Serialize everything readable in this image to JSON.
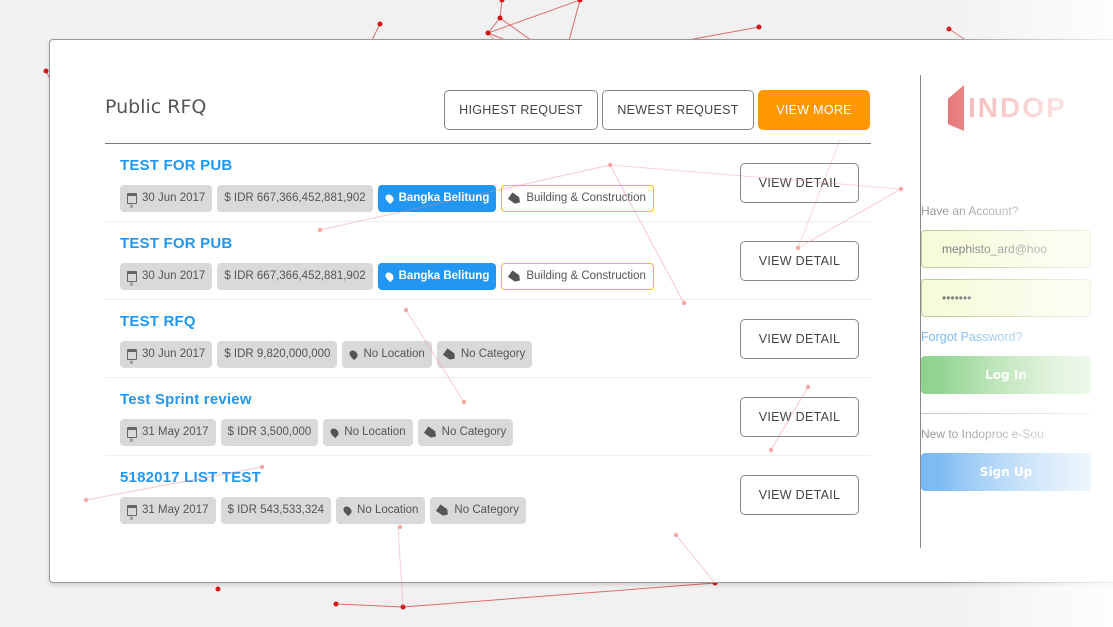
{
  "panel": {
    "title": "Public RFQ",
    "filters": {
      "highest": "HIGHEST REQUEST",
      "newest": "NEWEST REQUEST",
      "view_more": "VIEW MORE"
    },
    "detail_label": "VIEW DETAIL",
    "items": [
      {
        "title": "TEST FOR PUB",
        "date": "30 Jun 2017",
        "price": "$ IDR 667,366,452,881,902",
        "location": "Bangka Belitung",
        "category": "Building & Construction"
      },
      {
        "title": "TEST FOR PUB",
        "date": "30 Jun 2017",
        "price": "$ IDR 667,366,452,881,902",
        "location": "Bangka Belitung",
        "category": "Building & Construction"
      },
      {
        "title": "TEST RFQ",
        "date": "30 Jun 2017",
        "price": "$ IDR 9,820,000,000",
        "location": "No Location",
        "category": "No Category"
      },
      {
        "title": "Test Sprint review",
        "date": "31 May 2017",
        "price": "$ IDR 3,500,000",
        "location": "No Location",
        "category": "No Category"
      },
      {
        "title": "5182017 LIST TEST",
        "date": "31 May 2017",
        "price": "$ IDR 543,533,324",
        "location": "No Location",
        "category": "No Category"
      }
    ]
  },
  "login": {
    "brand": "INDOP",
    "have_account": "Have an Account?",
    "email_value": "mephisto_ard@hoo",
    "password_value": "•••••••",
    "forgot": "Forgot Password?",
    "login_label": "Log In",
    "new_to": "New to Indoproc e-Sou",
    "signup_label": "Sign Up"
  },
  "colors": {
    "link_blue": "#2196f3",
    "accent_orange": "#ff9800",
    "category_border": "#f0c000",
    "network_red": "#d00000"
  }
}
